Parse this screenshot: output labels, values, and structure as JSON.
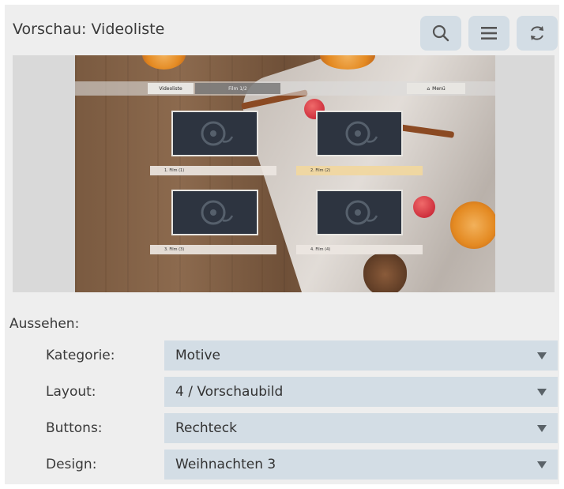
{
  "header": {
    "title": "Vorschau: Videoliste",
    "buttons": [
      {
        "icon": "search-icon"
      },
      {
        "icon": "menu-icon"
      },
      {
        "icon": "refresh-icon"
      }
    ]
  },
  "preview": {
    "nav": {
      "tab_active": "Videoliste",
      "tab_second": "Film 1/2",
      "menu": "Menü"
    },
    "tiles": [
      {
        "label": "1. Film (1)"
      },
      {
        "label": "2. Film (2)"
      },
      {
        "label": "3. Film (3)"
      },
      {
        "label": "4. Film (4)"
      }
    ],
    "selected_tile": 2
  },
  "appearance": {
    "section_label": "Aussehen:",
    "fields": [
      {
        "label": "Kategorie:",
        "value": "Motive"
      },
      {
        "label": "Layout:",
        "value": "4 / Vorschaubild"
      },
      {
        "label": "Buttons:",
        "value": "Rechteck"
      },
      {
        "label": "Design:",
        "value": "Weihnachten 3"
      }
    ]
  },
  "colors": {
    "panel_bg": "#eeeeee",
    "control_bg": "#d3dde5",
    "tile_bg": "#2d3440"
  }
}
